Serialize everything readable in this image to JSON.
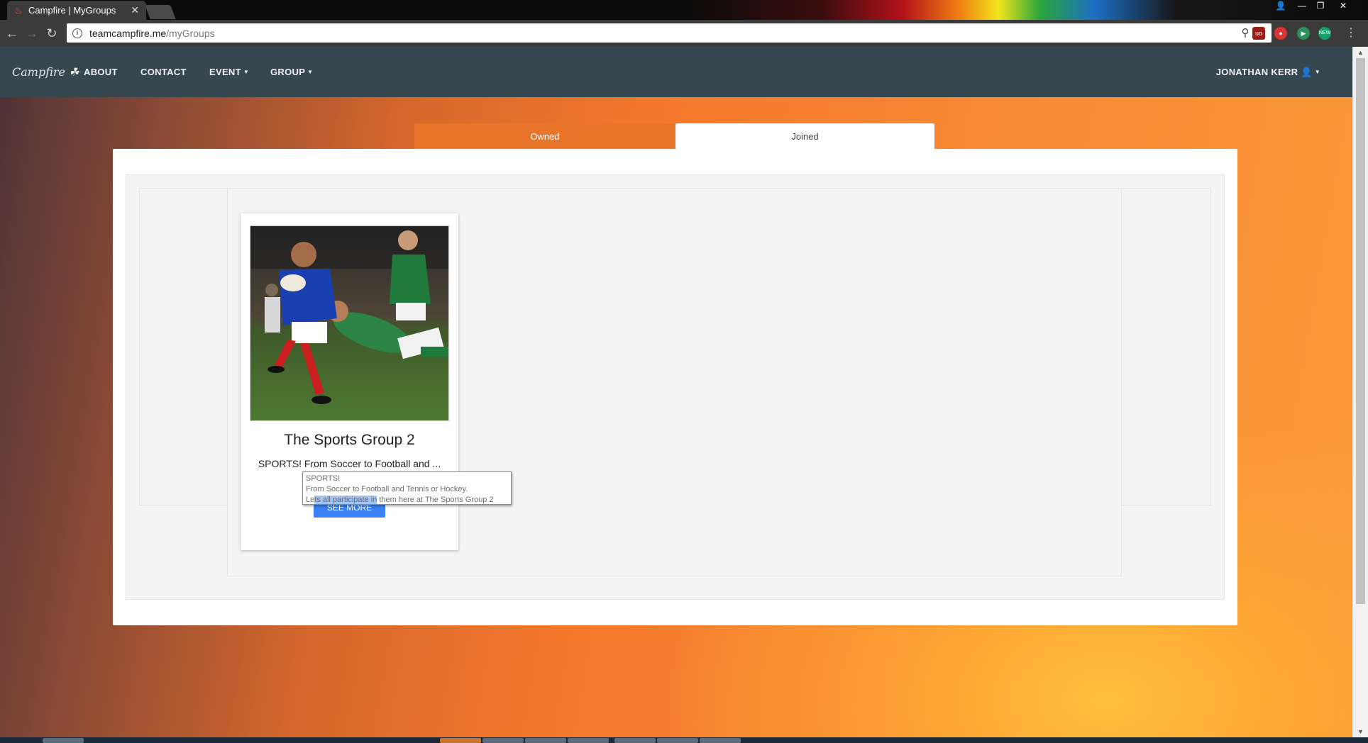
{
  "browser": {
    "tab_title": "Campfire | MyGroups",
    "tab_close": "✕",
    "url_host": "teamcampfire.me",
    "url_path": "/myGroups",
    "window_controls": [
      "👤",
      "—",
      "❐",
      "✕"
    ],
    "extensions": [
      {
        "name": "ublock-icon",
        "label": "uo",
        "color": "#9b1b1b"
      },
      {
        "name": "record-icon",
        "label": "●",
        "color": "#d33"
      },
      {
        "name": "play-icon",
        "label": "▶",
        "color": "#2d8f5c"
      },
      {
        "name": "grammarly-icon",
        "label": "NEW",
        "color": "#15a06b"
      }
    ]
  },
  "navbar": {
    "brand": "Campfire ☘",
    "links": {
      "about": "ABOUT",
      "contact": "CONTACT",
      "event": "EVENT",
      "group": "GROUP"
    },
    "user": "JONATHAN KERR"
  },
  "tabs": {
    "owned": "Owned",
    "joined": "Joined"
  },
  "card": {
    "title": "The Sports Group 2",
    "description": "SPORTS! From Soccer to Football and ...",
    "button": "SEE MORE",
    "tooltip": {
      "line1": "SPORTS!",
      "line2": "From Soccer to Football and Tennis or Hockey.",
      "line3_pre": "Le",
      "line3_hl": "ts all participate in",
      "line3_post": " them here at The Sports Group 2"
    }
  }
}
